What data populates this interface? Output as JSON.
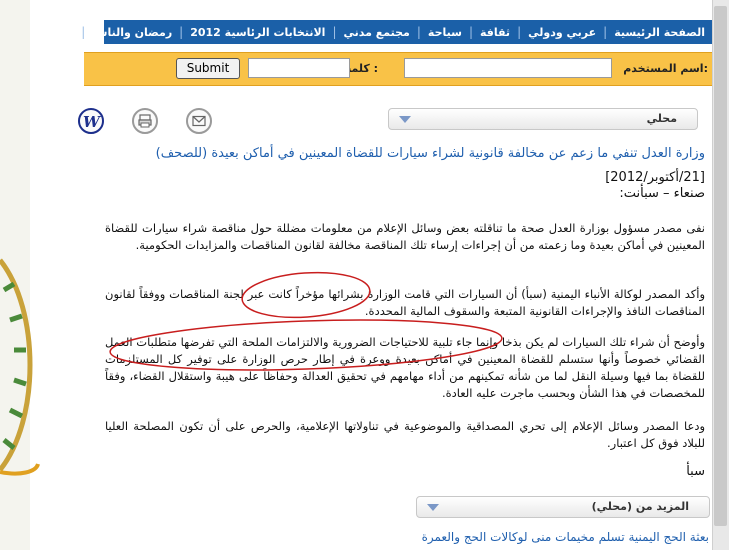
{
  "nav": {
    "items": [
      "الصفحة الرئيسية",
      "عربي ودولي",
      "ثقافة",
      "سياحة",
      "مجتمع مدني",
      "الانتخابات الرئاسية 2012",
      "رمضان والناس"
    ]
  },
  "login": {
    "username_label": "اسم المستخدم:",
    "password_label": "كلمة المرور :",
    "submit_label": "Submit"
  },
  "icons": [
    "email-icon",
    "print-icon",
    "w-logo-icon"
  ],
  "category_dropdown": {
    "selected": "محلي"
  },
  "article": {
    "headline": "وزارة العدل تنفي ما زعم عن مخالفة قانونية لشراء سيارات للقضاة المعينين في أماكن بعيدة (للصحف)",
    "date": "[21/أكتوبر/2012]",
    "dateline": "صنعاء – سبأنت:",
    "paragraphs": [
      "نفى مصدر مسؤول بوزارة العدل صحة ما تناقلته بعض وسائل الإعلام من معلومات مضللة حول مناقصة شراء سيارات للقضاة المعينين في أماكن بعيدة وما زعمته من أن إجراءات إرساء تلك المناقصة مخالفة لقانون المناقصات والمزايدات الحكومية.",
      "وأكد المصدر لوكالة الأنباء اليمنية (سبأ) أن السيارات التي قامت الوزارة بشرائها مؤخراً كانت عبر لجنة المناقصات ووفقاً لقانون المناقصات النافذ والإجراءات القانونية المتبعة والسقوف المالية المحددة.",
      "وأوضح أن شراء تلك السيارات لم يكن بذخا وإنما جاء تلبية للاحتياجات الضرورية والالتزامات الملحة التي تفرضها متطلبات العمل القضائي خصوصاً وأنها ستسلم للقضاة المعينين في أماكن بعيدة ووعرة في إطار حرص الوزارة على توفير كل المستلزمات للقضاة بما فيها وسيلة النقل لما من شأنه تمكينهم من أداء مهامهم في تحقيق العدالة وحفاظاً على هيبة واستقلال القضاء، وفقاً للمخصصات في هذا الشأن وبحسب ماجرت عليه العادة.",
      "ودعا المصدر وسائل الإعلام إلى تحري المصداقية والموضوعية في تناولاتها الإعلامية، والحرص على أن تكون المصلحة العليا للبلاد فوق كل اعتبار."
    ],
    "signature": "سبأ"
  },
  "more_dropdown": {
    "label": "المزيد من (محلي)"
  },
  "related": {
    "link": "بعثة الحج اليمنية تسلم مخيمات منى لوكالات الحج والعمرة"
  },
  "colors": {
    "nav_bg": "#1b60a8",
    "login_bg": "#f9c247",
    "link": "#1f5fae",
    "annotation_red": "#c81e1e"
  }
}
